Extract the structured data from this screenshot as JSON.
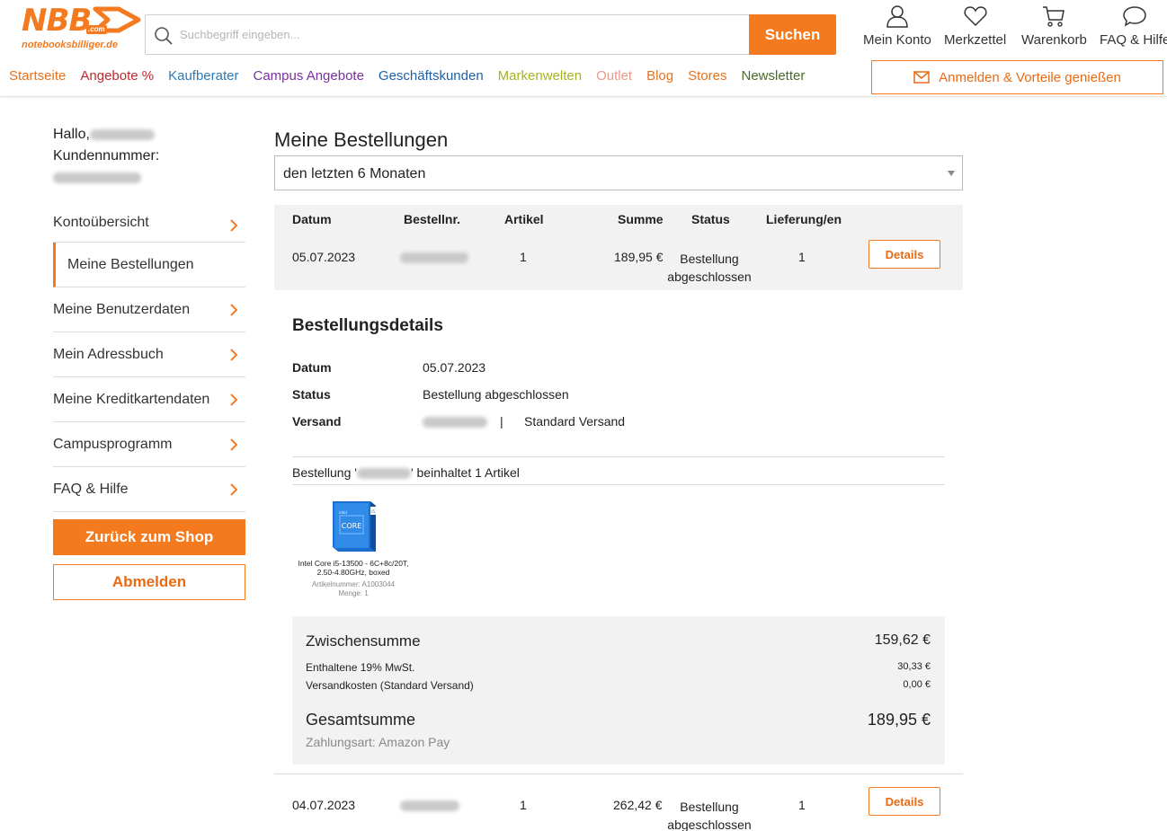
{
  "logo": {
    "brand": "NBB",
    "tld": ".com",
    "domain": "notebooksbilliger.de"
  },
  "search": {
    "placeholder": "Suchbegriff eingeben...",
    "button": "Suchen"
  },
  "header_icons": [
    {
      "label": "Mein Konto",
      "icon": "user-icon"
    },
    {
      "label": "Merkzettel",
      "icon": "heart-icon"
    },
    {
      "label": "Warenkorb",
      "icon": "cart-icon"
    },
    {
      "label": "FAQ & Hilfe",
      "icon": "chat-bubble-icon"
    }
  ],
  "nav": [
    {
      "label": "Startseite",
      "color": "#e8711a"
    },
    {
      "label": "Angebote %",
      "color": "#c0282d"
    },
    {
      "label": "Kaufberater",
      "color": "#2a7ab8"
    },
    {
      "label": "Campus Angebote",
      "color": "#7a2fa0"
    },
    {
      "label": "Geschäftskunden",
      "color": "#1f5fa6"
    },
    {
      "label": "Markenwelten",
      "color": "#a6b422"
    },
    {
      "label": "Outlet",
      "color": "#e89a8a"
    },
    {
      "label": "Blog",
      "color": "#e8711a"
    },
    {
      "label": "Stores",
      "color": "#e8711a"
    },
    {
      "label": "Newsletter",
      "color": "#4a6a2a"
    }
  ],
  "login_button": "Anmelden & Vorteile genießen",
  "sidebar": {
    "greeting": "Hallo,",
    "customer_number_label": "Kundennummer:",
    "items": [
      {
        "label": "Kontoübersicht"
      },
      {
        "label": "Meine Bestellungen"
      },
      {
        "label": "Meine Benutzerdaten"
      },
      {
        "label": "Mein Adressbuch"
      },
      {
        "label": "Meine Kreditkartendaten"
      },
      {
        "label": "Campusprogramm"
      },
      {
        "label": "FAQ & Hilfe"
      }
    ],
    "back_button": "Zurück zum Shop",
    "logout_button": "Abmelden"
  },
  "main": {
    "title": "Meine Bestellungen",
    "filter": "den letzten 6 Monaten",
    "columns": [
      "Datum",
      "Bestellnr.",
      "Artikel",
      "Summe",
      "Status",
      "Lieferung/en"
    ],
    "orders": [
      {
        "date": "05.07.2023",
        "articles": "1",
        "sum": "189,95 €",
        "status_line1": "Bestellung",
        "status_line2": "abgeschlossen",
        "deliveries": "1",
        "details": "Details"
      },
      {
        "date": "04.07.2023",
        "articles": "1",
        "sum": "262,42 €",
        "status_line1": "Bestellung",
        "status_line2": "abgeschlossen",
        "deliveries": "1",
        "details": "Details"
      }
    ],
    "details": {
      "title": "Bestellungsdetails",
      "date_label": "Datum",
      "date_value": "05.07.2023",
      "status_label": "Status",
      "status_value": "Bestellung abgeschlossen",
      "shipping_label": "Versand",
      "shipping_sep": "|",
      "shipping_value": "Standard Versand",
      "contains_prefix": "Bestellung '",
      "contains_suffix": "' beinhaltet 1 Artikel",
      "product": {
        "name_line1": "Intel Core i5-13500 - 6C+8c/20T,",
        "name_line2": "2.50-4.80GHz, boxed",
        "article_number": "Artikelnummer: A1003044",
        "quantity": "Menge: 1",
        "box_brand": "intel",
        "box_text": "CORE",
        "box_badge": "i5"
      }
    },
    "summary": {
      "subtotal_label": "Zwischensumme",
      "subtotal_value": "159,62 €",
      "vat_label": "Enthaltene 19% MwSt.",
      "vat_value": "30,33 €",
      "shipping_label": "Versandkosten (Standard Versand)",
      "shipping_value": "0,00 €",
      "total_label": "Gesamtsumme",
      "total_value": "189,95 €",
      "payment": "Zahlungsart: Amazon Pay"
    }
  }
}
